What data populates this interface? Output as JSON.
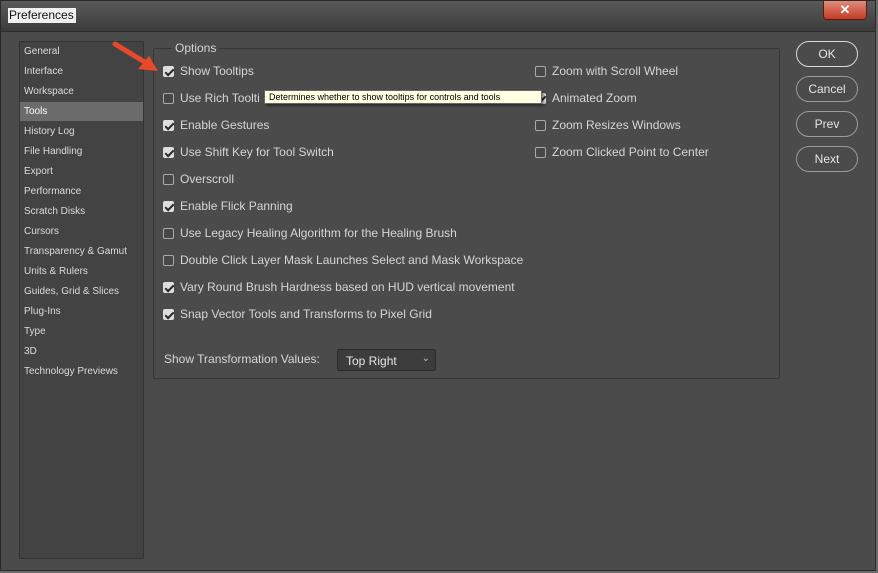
{
  "window": {
    "title": "Preferences",
    "close_label": "✕"
  },
  "sidebar": {
    "items": [
      {
        "label": "General"
      },
      {
        "label": "Interface"
      },
      {
        "label": "Workspace"
      },
      {
        "label": "Tools",
        "selected": true
      },
      {
        "label": "History Log"
      },
      {
        "label": "File Handling"
      },
      {
        "label": "Export"
      },
      {
        "label": "Performance"
      },
      {
        "label": "Scratch Disks"
      },
      {
        "label": "Cursors"
      },
      {
        "label": "Transparency & Gamut"
      },
      {
        "label": "Units & Rulers"
      },
      {
        "label": "Guides, Grid & Slices"
      },
      {
        "label": "Plug-Ins"
      },
      {
        "label": "Type"
      },
      {
        "label": "3D"
      },
      {
        "label": "Technology Previews"
      }
    ]
  },
  "options": {
    "legend": "Options",
    "left_checkboxes": [
      {
        "label": "Show Tooltips",
        "checked": true
      },
      {
        "label": "Use Rich Toolti",
        "checked": false
      },
      {
        "label": "Enable Gestures",
        "checked": true
      },
      {
        "label": "Use Shift Key for Tool Switch",
        "checked": true
      },
      {
        "label": "Overscroll",
        "checked": false
      },
      {
        "label": "Enable Flick Panning",
        "checked": true
      },
      {
        "label": "Use Legacy Healing Algorithm for the Healing Brush",
        "checked": false
      },
      {
        "label": "Double Click Layer Mask Launches Select and Mask Workspace",
        "checked": false
      },
      {
        "label": "Vary Round Brush Hardness based on HUD vertical movement",
        "checked": true
      },
      {
        "label": "Snap Vector Tools and Transforms to Pixel Grid",
        "checked": true
      }
    ],
    "right_checkboxes": [
      {
        "label": "Zoom with Scroll Wheel",
        "checked": false
      },
      {
        "label": "Animated Zoom",
        "checked": true
      },
      {
        "label": "Zoom Resizes Windows",
        "checked": false
      },
      {
        "label": "Zoom Clicked Point to Center",
        "checked": false
      }
    ],
    "tooltip": "Determines whether to show tooltips for controls and tools",
    "transform_label": "Show Transformation Values:",
    "transform_value": "Top Right"
  },
  "buttons": {
    "ok": "OK",
    "cancel": "Cancel",
    "prev": "Prev",
    "next": "Next"
  },
  "colors": {
    "annotation_arrow": "#e8492a",
    "selected_item": "#6b6b6b"
  }
}
